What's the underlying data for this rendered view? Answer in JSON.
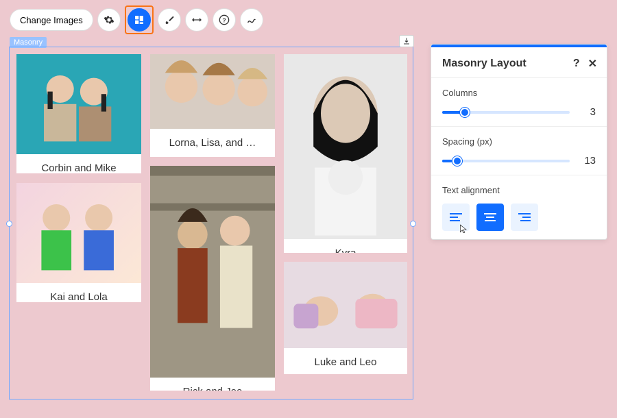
{
  "toolbar": {
    "change_images_label": "Change Images"
  },
  "canvas": {
    "tag": "Masonry"
  },
  "cards": [
    {
      "caption": "Corbin and Mike"
    },
    {
      "caption": "Lorna, Lisa, and …"
    },
    {
      "caption": "Kyra"
    },
    {
      "caption": "Kai and Lola"
    },
    {
      "caption": "Rick and Joe"
    },
    {
      "caption": "Luke and Leo"
    }
  ],
  "panel": {
    "title": "Masonry Layout",
    "columns_label": "Columns",
    "columns_value": "3",
    "spacing_label": "Spacing (px)",
    "spacing_value": "13",
    "align_label": "Text alignment"
  }
}
